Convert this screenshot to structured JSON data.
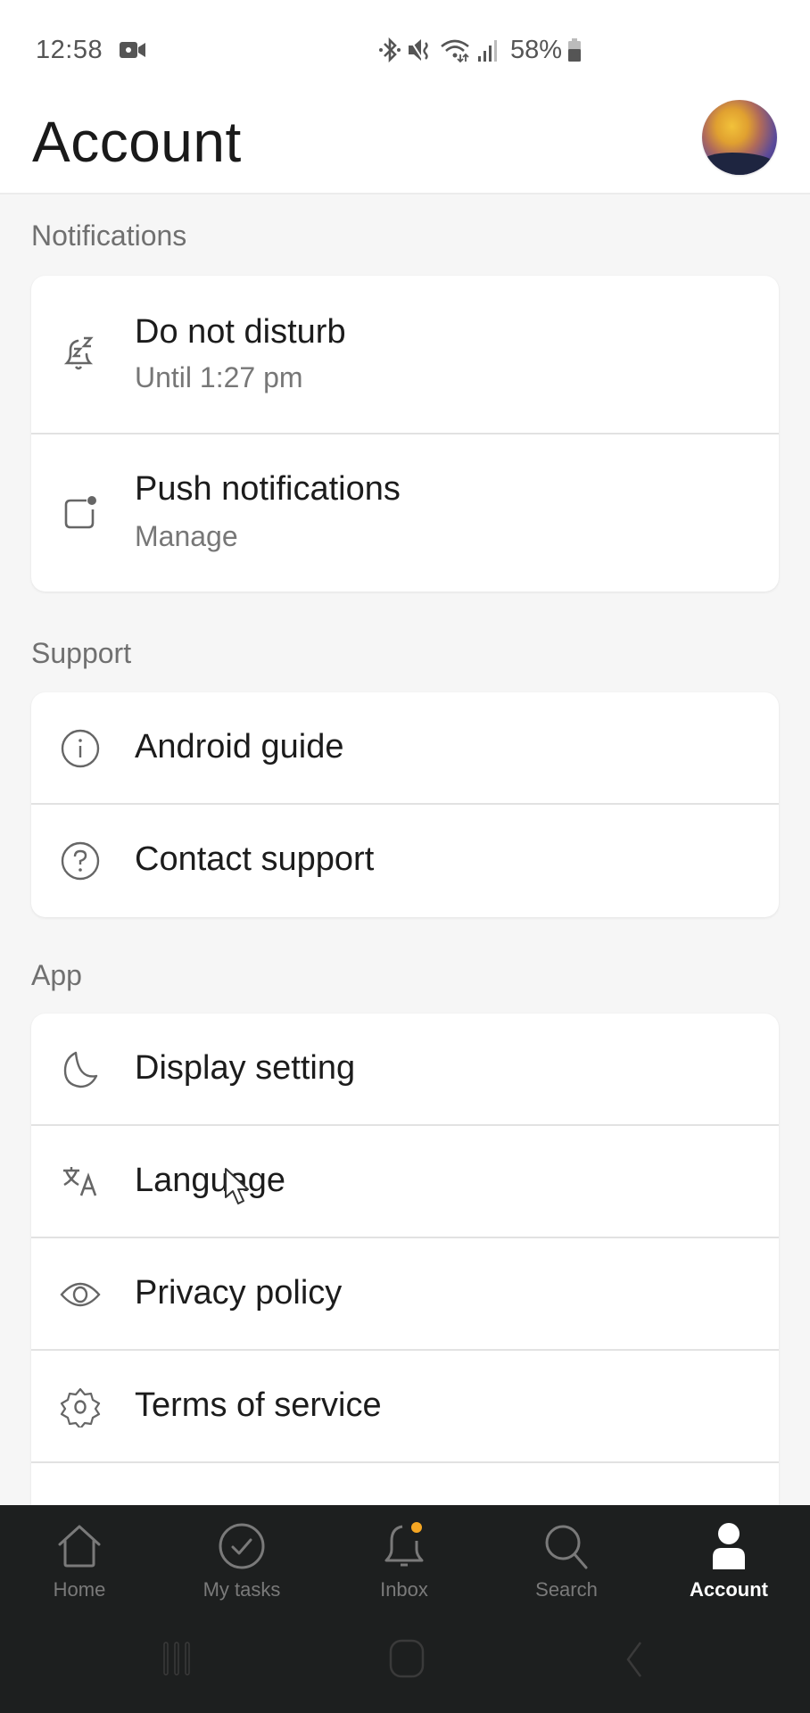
{
  "status_bar": {
    "time": "12:58",
    "battery_percent": "58%",
    "icons": [
      "screen-record-icon",
      "bluetooth-icon",
      "mute-icon",
      "wifi-icon",
      "signal-icon",
      "battery-icon"
    ]
  },
  "header": {
    "title": "Account",
    "avatar": "profile-avatar"
  },
  "sections": [
    {
      "label": "Notifications",
      "items": [
        {
          "icon": "snooze-bell-icon",
          "title": "Do not disturb",
          "subtitle": "Until 1:27 pm"
        },
        {
          "icon": "push-notification-icon",
          "title": "Push notifications",
          "subtitle": "Manage"
        }
      ]
    },
    {
      "label": "Support",
      "items": [
        {
          "icon": "info-icon",
          "title": "Android guide"
        },
        {
          "icon": "help-icon",
          "title": "Contact support"
        }
      ]
    },
    {
      "label": "App",
      "items": [
        {
          "icon": "moon-icon",
          "title": "Display setting"
        },
        {
          "icon": "translate-icon",
          "title": "Language"
        },
        {
          "icon": "eye-icon",
          "title": "Privacy policy"
        },
        {
          "icon": "gear-icon",
          "title": "Terms of service"
        }
      ]
    }
  ],
  "bottom_nav": {
    "items": [
      {
        "label": "Home",
        "icon": "home-icon",
        "active": false
      },
      {
        "label": "My tasks",
        "icon": "check-circle-icon",
        "active": false
      },
      {
        "label": "Inbox",
        "icon": "bell-icon",
        "active": false,
        "badge": true
      },
      {
        "label": "Search",
        "icon": "search-icon",
        "active": false
      },
      {
        "label": "Account",
        "icon": "person-icon",
        "active": true
      }
    ],
    "badge_color": "#f5a623"
  },
  "system_nav": [
    "recent-apps-button",
    "home-button",
    "back-button"
  ]
}
